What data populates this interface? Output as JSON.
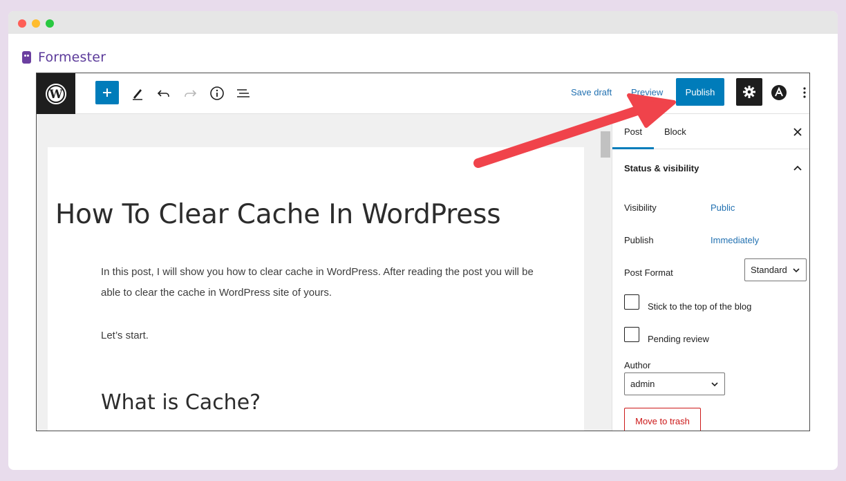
{
  "brand": {
    "name": "Formester"
  },
  "toolbar": {
    "save_draft": "Save draft",
    "preview": "Preview",
    "publish": "Publish",
    "icons": [
      "wordpress-icon",
      "plus-icon",
      "pencil-icon",
      "undo-icon",
      "redo-icon",
      "info-icon",
      "list-view-icon",
      "gear-icon",
      "astra-icon",
      "more-vertical-icon"
    ]
  },
  "post": {
    "title": "How To Clear Cache In WordPress",
    "paragraph1": "In this post, I will show you how to clear cache in WordPress. After reading the post you will be able to clear the cache in WordPress site of yours.",
    "paragraph2": "Let’s start.",
    "heading2": "What is Cache?"
  },
  "sidebar": {
    "tabs": [
      "Post",
      "Block"
    ],
    "section_title": "Status & visibility",
    "visibility_label": "Visibility",
    "visibility_value": "Public",
    "publish_label": "Publish",
    "publish_value": "Immediately",
    "post_format_label": "Post Format",
    "post_format_value": "Standard",
    "sticky_label": "Stick to the top of the blog",
    "pending_label": "Pending review",
    "author_label": "Author",
    "author_value": "admin",
    "trash_label": "Move to trash"
  },
  "colors": {
    "accent": "#007cba",
    "arrow": "#f0434b",
    "brand": "#5b3a9a",
    "danger": "#cc1818"
  }
}
